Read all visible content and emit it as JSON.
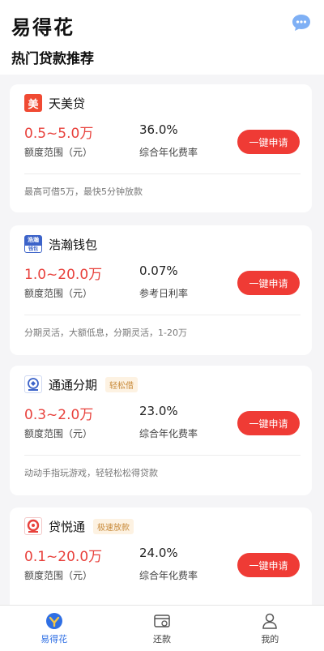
{
  "header": {
    "app_title": "易得花",
    "chat_icon": "chat-bubble-icon",
    "section_title": "热门贷款推荐"
  },
  "products": [
    {
      "logo_text": "美",
      "name": "天美贷",
      "tag": "",
      "amount": "0.5~5.0万",
      "amount_label": "额度范围（元）",
      "rate": "36.0%",
      "rate_label": "综合年化费率",
      "button": "一键申请",
      "desc": "最高可借5万，最快5分钟放款"
    },
    {
      "logo_text": "浩瀚",
      "logo_text2": "钱包",
      "name": "浩瀚钱包",
      "tag": "",
      "amount": "1.0~20.0万",
      "amount_label": "额度范围（元）",
      "rate": "0.07%",
      "rate_label": "参考日利率",
      "button": "一键申请",
      "desc": "分期灵活，大额低息，分期灵活，1-20万"
    },
    {
      "name": "通通分期",
      "tag": "轻松借",
      "amount": "0.3~2.0万",
      "amount_label": "额度范围（元）",
      "rate": "23.0%",
      "rate_label": "综合年化费率",
      "button": "一键申请",
      "desc": "动动手指玩游戏，轻轻松松得贷款"
    },
    {
      "name": "贷悦通",
      "tag": "极速放款",
      "amount": "0.1~20.0万",
      "amount_label": "额度范围（元）",
      "rate": "24.0%",
      "rate_label": "综合年化费率",
      "button": "一键申请",
      "desc": ""
    }
  ],
  "tabbar": [
    {
      "label": "易得花",
      "icon": "home-icon",
      "active": true
    },
    {
      "label": "还款",
      "icon": "repay-icon",
      "active": false
    },
    {
      "label": "我的",
      "icon": "user-icon",
      "active": false
    }
  ],
  "colors": {
    "accent_red": "#ef3b35",
    "amount_red": "#e8413c",
    "active_blue": "#2f6fe4"
  }
}
